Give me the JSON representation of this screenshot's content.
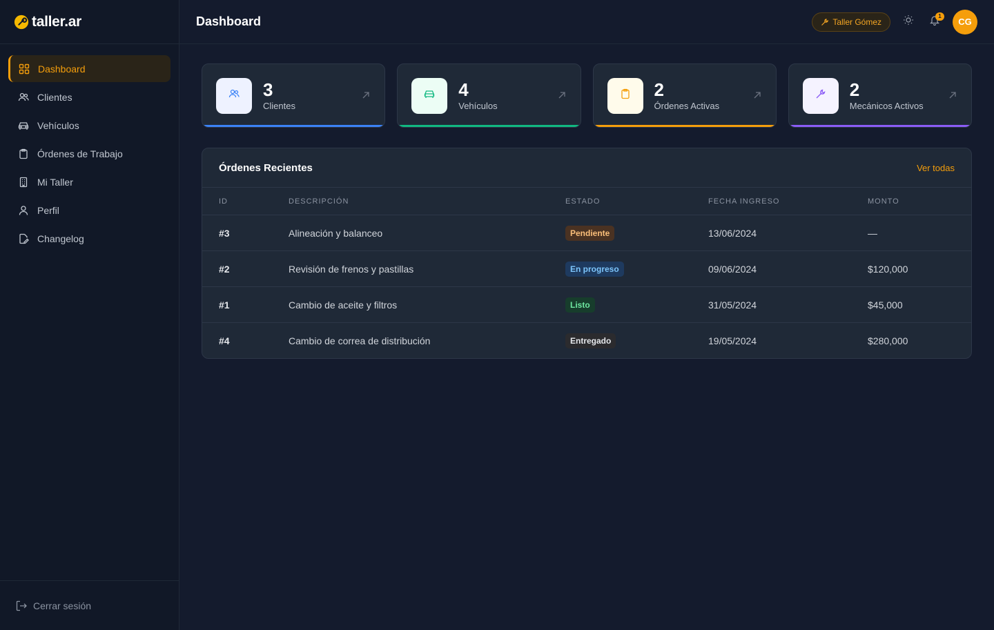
{
  "brand": {
    "name": "taller.ar",
    "accent": "#f59e0b"
  },
  "sidebar": {
    "items": [
      {
        "label": "Dashboard",
        "icon": "grid-icon",
        "active": true
      },
      {
        "label": "Clientes",
        "icon": "users-icon"
      },
      {
        "label": "Vehículos",
        "icon": "car-icon"
      },
      {
        "label": "Órdenes de Trabajo",
        "icon": "clipboard-icon"
      },
      {
        "label": "Mi Taller",
        "icon": "building-icon"
      },
      {
        "label": "Perfil",
        "icon": "user-icon"
      },
      {
        "label": "Changelog",
        "icon": "file-edit-icon"
      }
    ],
    "logout_label": "Cerrar sesión"
  },
  "header": {
    "title": "Dashboard",
    "shop_label": "Taller Gómez",
    "notification_count": "1",
    "avatar_initials": "CG"
  },
  "stats": [
    {
      "value": "3",
      "label": "Clientes",
      "icon": "users-icon",
      "color": "#3b82f6",
      "icon_bg": "#eef2ff"
    },
    {
      "value": "4",
      "label": "Vehículos",
      "icon": "car-icon",
      "color": "#10b981",
      "icon_bg": "#ecfdf5"
    },
    {
      "value": "2",
      "label": "Órdenes Activas",
      "icon": "clipboard-icon",
      "color": "#f59e0b",
      "icon_bg": "#fffbeb"
    },
    {
      "value": "2",
      "label": "Mecánicos Activos",
      "icon": "wrench-icon",
      "color": "#8b5cf6",
      "icon_bg": "#f5f3ff"
    }
  ],
  "orders": {
    "title": "Órdenes Recientes",
    "see_all": "Ver todas",
    "columns": [
      "ID",
      "DESCRIPCIÓN",
      "ESTADO",
      "FECHA INGRESO",
      "MONTO"
    ],
    "rows": [
      {
        "id": "#3",
        "description": "Alineación y balanceo",
        "status": "Pendiente",
        "date": "13/06/2024",
        "amount": "—"
      },
      {
        "id": "#2",
        "description": "Revisión de frenos y pastillas",
        "status": "En progreso",
        "date": "09/06/2024",
        "amount": "$120,000"
      },
      {
        "id": "#1",
        "description": "Cambio de aceite y filtros",
        "status": "Listo",
        "date": "31/05/2024",
        "amount": "$45,000"
      },
      {
        "id": "#4",
        "description": "Cambio de correa de distribución",
        "status": "Entregado",
        "date": "19/05/2024",
        "amount": "$280,000"
      }
    ],
    "status_colors": {
      "Pendiente": {
        "bg": "#4a3222",
        "fg": "#fbbf7a"
      },
      "En progreso": {
        "bg": "#1e3a5f",
        "fg": "#7cc4fa"
      },
      "Listo": {
        "bg": "#173d2c",
        "fg": "#6ee7a0"
      },
      "Entregado": {
        "bg": "#2b2b2e",
        "fg": "#e5e7eb"
      }
    }
  }
}
